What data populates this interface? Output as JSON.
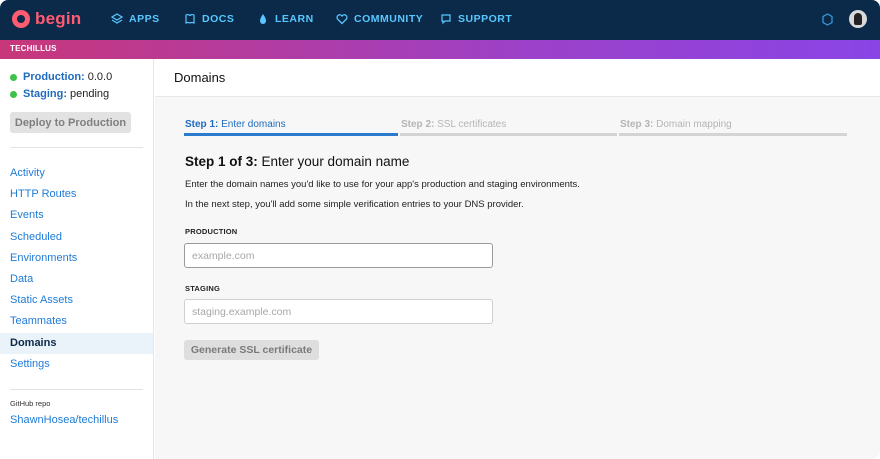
{
  "nav": {
    "logo": "begin",
    "items": [
      {
        "label": "APPS",
        "icon": "apps-icon"
      },
      {
        "label": "DOCS",
        "icon": "docs-icon"
      },
      {
        "label": "LEARN",
        "icon": "learn-icon"
      },
      {
        "label": "COMMUNITY",
        "icon": "community-icon"
      },
      {
        "label": "SUPPORT",
        "icon": "support-icon"
      }
    ]
  },
  "org": {
    "name": "TECHILLUS"
  },
  "sidebar": {
    "production": {
      "label": "Production:",
      "value": "0.0.0"
    },
    "staging": {
      "label": "Staging:",
      "value": "pending"
    },
    "deploy_label": "Deploy to Production",
    "items": [
      {
        "label": "Activity"
      },
      {
        "label": "HTTP Routes"
      },
      {
        "label": "Events"
      },
      {
        "label": "Scheduled"
      },
      {
        "label": "Environments"
      },
      {
        "label": "Data"
      },
      {
        "label": "Static Assets"
      },
      {
        "label": "Teammates"
      },
      {
        "label": "Domains"
      },
      {
        "label": "Settings"
      }
    ],
    "repo_label": "GitHub repo",
    "repo_link": "ShawnHosea/techillus"
  },
  "main": {
    "title": "Domains",
    "steps": [
      {
        "num": "Step 1:",
        "label": "Enter domains"
      },
      {
        "num": "Step 2:",
        "label": "SSL certificates"
      },
      {
        "num": "Step 3:",
        "label": "Domain mapping"
      }
    ],
    "heading_num": "Step 1 of 3:",
    "heading_text": "Enter your domain name",
    "desc1": "Enter the domain names you'd like to use for your app's production and staging environments.",
    "desc2": "In the next step, you'll add some simple verification entries to your DNS provider.",
    "production_label": "PRODUCTION",
    "production_placeholder": "example.com",
    "staging_label": "STAGING",
    "staging_placeholder": "staging.example.com",
    "generate_label": "Generate SSL certificate"
  },
  "colors": {
    "nav_bg": "#0b2a4a",
    "nav_text": "#59c7ff",
    "logo": "#ff5b71",
    "link": "#1f7bd6",
    "status_green": "#3dc14a",
    "step_active": "#2b7bcf"
  }
}
